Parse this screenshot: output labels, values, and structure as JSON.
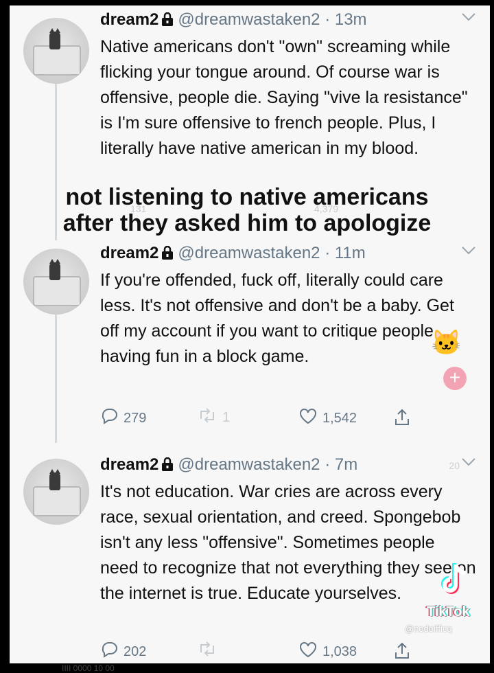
{
  "tweets": [
    {
      "name": "dream2",
      "handle": "@dreamwastaken2",
      "time": "13m",
      "text": "Native americans don't \"own\" screaming while flicking your tongue around. Of course war is offensive, people die. Saying \"vive la resistance\" is I'm sure offensive to french people. Plus, I literally have native american in my blood."
    },
    {
      "name": "dream2",
      "handle": "@dreamwastaken2",
      "time": "11m",
      "text": "If you're offended, fuck off, literally could care less. It's not offensive and don't be a baby. Get off my account if you want to critique people having fun in a block game.",
      "replies": "279",
      "retweets": "1",
      "likes": "1,542"
    },
    {
      "name": "dream2",
      "handle": "@dreamwastaken2",
      "time": "7m",
      "text": "It's not education. War cries are across every race, sexual orientation, and creed. Spongebob isn't any less \"offensive\". Sometimes people need to recognize that not everything they see on the internet is true. Educate yourselves.",
      "replies": "202",
      "retweets": "",
      "likes": "1,038"
    }
  ],
  "overlay": {
    "line1": "not listening to native americans",
    "line2": "after they asked him to apologize"
  },
  "ghost_counts": {
    "left": "131",
    "right": "4,379"
  },
  "watermark": {
    "brand": "TikTok",
    "handle": "@nodoifficq",
    "corner": "20"
  },
  "bottom_text": "IIII 0000 10 00",
  "icons": [
    "lock-icon",
    "chevron-down-icon",
    "reply-icon",
    "retweet-icon",
    "like-icon",
    "share-icon",
    "tiktok-logo-icon"
  ],
  "colors": {
    "text": "#111111",
    "muted": "#657786",
    "background": "#f7f7f7"
  }
}
